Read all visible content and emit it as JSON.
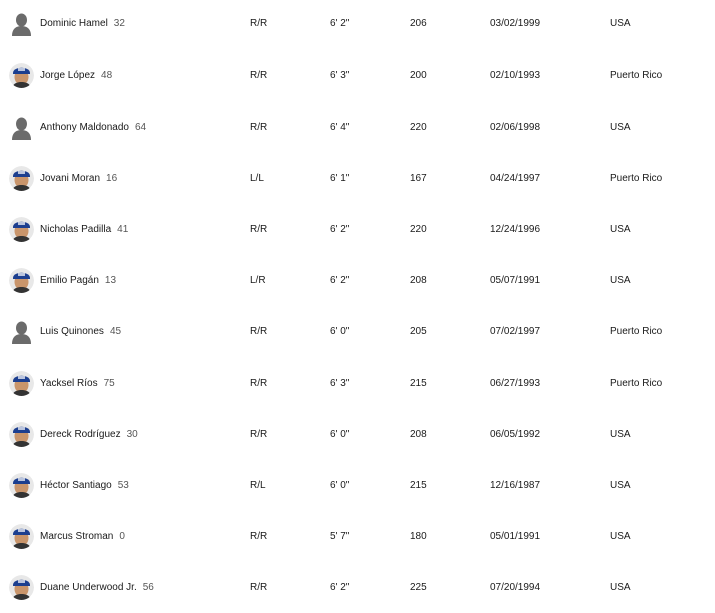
{
  "roster": {
    "players": [
      {
        "name": "Dominic Hamel",
        "number": "32",
        "bt": "R/R",
        "height": "6' 2\"",
        "weight": "206",
        "dob": "03/02/1999",
        "birthplace": "USA",
        "avatar": "silhouette-icon"
      },
      {
        "name": "Jorge López",
        "number": "48",
        "bt": "R/R",
        "height": "6' 3\"",
        "weight": "200",
        "dob": "02/10/1993",
        "birthplace": "Puerto Rico",
        "avatar": "player-headshot-icon"
      },
      {
        "name": "Anthony Maldonado",
        "number": "64",
        "bt": "R/R",
        "height": "6' 4\"",
        "weight": "220",
        "dob": "02/06/1998",
        "birthplace": "USA",
        "avatar": "silhouette-icon"
      },
      {
        "name": "Jovani Moran",
        "number": "16",
        "bt": "L/L",
        "height": "6' 1\"",
        "weight": "167",
        "dob": "04/24/1997",
        "birthplace": "Puerto Rico",
        "avatar": "player-headshot-icon"
      },
      {
        "name": "Nicholas Padilla",
        "number": "41",
        "bt": "R/R",
        "height": "6' 2\"",
        "weight": "220",
        "dob": "12/24/1996",
        "birthplace": "USA",
        "avatar": "player-headshot-icon"
      },
      {
        "name": "Emilio Pagán",
        "number": "13",
        "bt": "L/R",
        "height": "6' 2\"",
        "weight": "208",
        "dob": "05/07/1991",
        "birthplace": "USA",
        "avatar": "player-headshot-icon"
      },
      {
        "name": "Luis Quinones",
        "number": "45",
        "bt": "R/R",
        "height": "6' 0\"",
        "weight": "205",
        "dob": "07/02/1997",
        "birthplace": "Puerto Rico",
        "avatar": "silhouette-icon"
      },
      {
        "name": "Yacksel Ríos",
        "number": "75",
        "bt": "R/R",
        "height": "6' 3\"",
        "weight": "215",
        "dob": "06/27/1993",
        "birthplace": "Puerto Rico",
        "avatar": "player-headshot-icon"
      },
      {
        "name": "Dereck Rodríguez",
        "number": "30",
        "bt": "R/R",
        "height": "6' 0\"",
        "weight": "208",
        "dob": "06/05/1992",
        "birthplace": "USA",
        "avatar": "player-headshot-icon"
      },
      {
        "name": "Héctor Santiago",
        "number": "53",
        "bt": "R/L",
        "height": "6' 0\"",
        "weight": "215",
        "dob": "12/16/1987",
        "birthplace": "USA",
        "avatar": "player-headshot-icon"
      },
      {
        "name": "Marcus Stroman",
        "number": "0",
        "bt": "R/R",
        "height": "5' 7\"",
        "weight": "180",
        "dob": "05/01/1991",
        "birthplace": "USA",
        "avatar": "player-headshot-icon"
      },
      {
        "name": "Duane Underwood Jr.",
        "number": "56",
        "bt": "R/R",
        "height": "6' 2\"",
        "weight": "225",
        "dob": "07/20/1994",
        "birthplace": "USA",
        "avatar": "player-headshot-icon"
      }
    ]
  },
  "colors": {
    "text": "#1a1a1a",
    "number": "#555555",
    "silhouette_bg": "#d9d9d9",
    "silhouette_fg": "#6b6b6b",
    "cap_blue": "#1d3f8f",
    "skin": "#c9956b"
  }
}
